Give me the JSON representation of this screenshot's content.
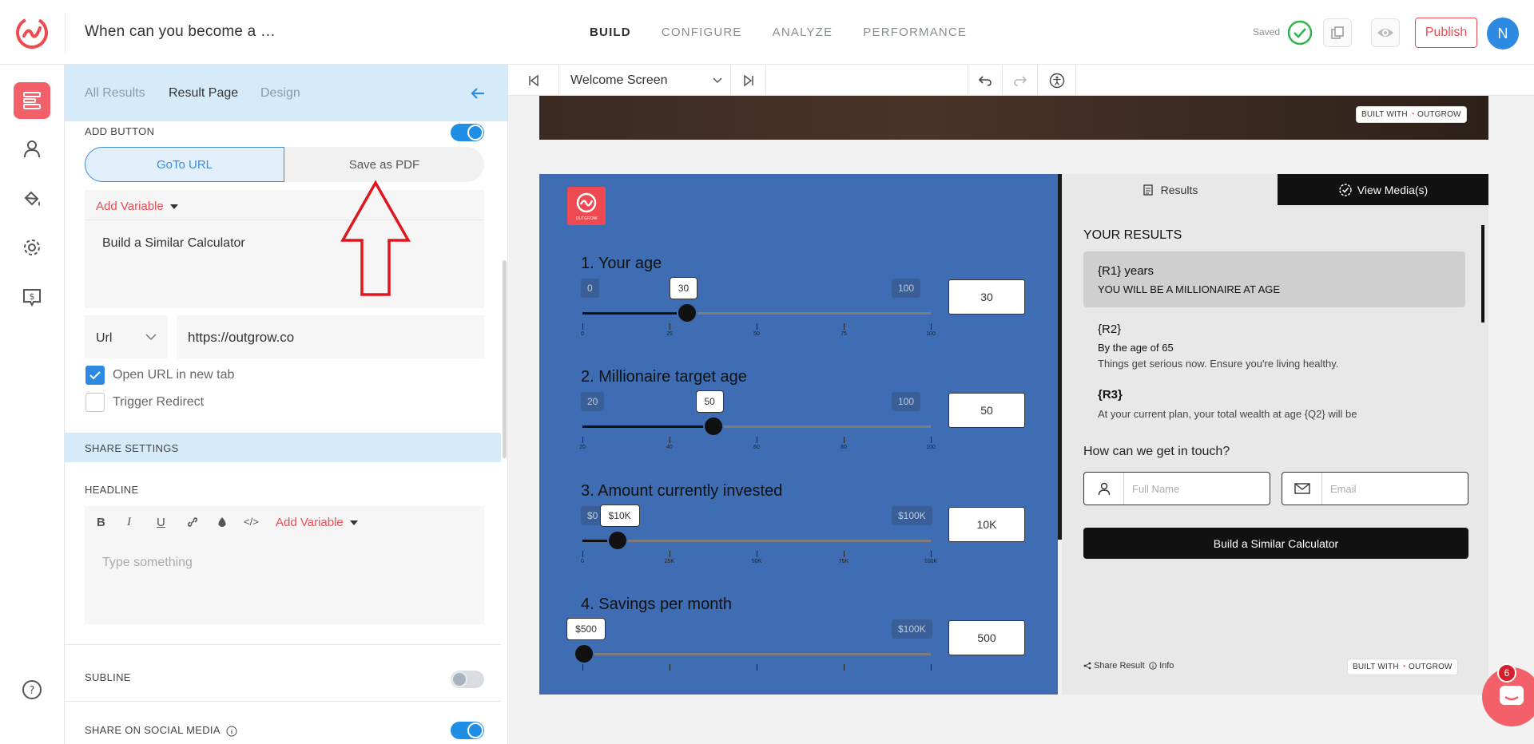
{
  "header": {
    "doc_title": "When can you become a …",
    "tabs": [
      "BUILD",
      "CONFIGURE",
      "ANALYZE",
      "PERFORMANCE"
    ],
    "active_tab": "BUILD",
    "saved_label": "Saved",
    "publish_label": "Publish",
    "avatar_initial": "N"
  },
  "panel": {
    "tabs": [
      "All Results",
      "Result Page",
      "Design"
    ],
    "active_tab": "Result Page",
    "add_button_label": "ADD BUTTON",
    "goto_url_label": "GoTo URL",
    "save_pdf_label": "Save as PDF",
    "add_variable_label": "Add Variable",
    "button_text": "Build a Similar Calculator",
    "url_type": "Url",
    "url_value": "https://outgrow.co",
    "open_new_tab_label": "Open URL in new tab",
    "open_new_tab_checked": true,
    "trigger_redirect_label": "Trigger Redirect",
    "trigger_redirect_checked": false,
    "share_settings_label": "SHARE SETTINGS",
    "headline_label": "HEADLINE",
    "headline_placeholder": "Type something",
    "headline_add_variable": "Add Variable",
    "subline_label": "SUBLINE",
    "share_social_label": "SHARE ON SOCIAL MEDIA"
  },
  "preview": {
    "screen_select": "Welcome Screen",
    "built_with": "BUILT WITH",
    "brand": "OUTGROW",
    "logo_caption": "OUTGROW",
    "questions": [
      {
        "title": "1.  Your age",
        "min": "0",
        "max": "100",
        "value_chip": "30",
        "box": "30",
        "fraction": 0.3,
        "ticks": [
          "0",
          "25",
          "50",
          "75",
          "100"
        ]
      },
      {
        "title": "2.  Millionaire target age",
        "min": "20",
        "max": "100",
        "value_chip": "50",
        "box": "50",
        "fraction": 0.375,
        "ticks": [
          "20",
          "40",
          "60",
          "80",
          "100"
        ]
      },
      {
        "title": "3.  Amount currently invested",
        "min": "$0",
        "max": "$100K",
        "value_chip": "$10K",
        "box": "10K",
        "fraction": 0.1,
        "ticks": [
          "0",
          "25K",
          "50K",
          "75K",
          "100K"
        ]
      },
      {
        "title": "4.  Savings per month",
        "min": "",
        "max": "$100K",
        "value_chip": "$500",
        "box": "500",
        "fraction": 0.005,
        "ticks": [
          "",
          "",
          "",
          "",
          ""
        ]
      }
    ],
    "results_tab": "Results",
    "media_tab": "View Media(s)",
    "results_heading": "YOUR RESULTS",
    "r1_title": "{R1} years",
    "r1_sub": "YOU WILL BE A MILLIONAIRE AT AGE",
    "r2_title": "{R2}",
    "r2_sub": "By the age of 65",
    "r2_desc": "Things get serious now. Ensure you're living healthy.",
    "r3_title": "{R3}",
    "r3_desc": "At your current plan, your total wealth at age {Q2} will be",
    "touch_label": "How can we get in touch?",
    "fullname_placeholder": "Full Name",
    "email_placeholder": "Email",
    "cta_label": "Build a Similar Calculator",
    "share_result": "Share Result",
    "info": "Info"
  },
  "chat": {
    "badge": "6"
  },
  "colors": {
    "accent": "#ef4a51",
    "primary": "#2d8ae0",
    "calc_bg": "#3f6db3"
  }
}
